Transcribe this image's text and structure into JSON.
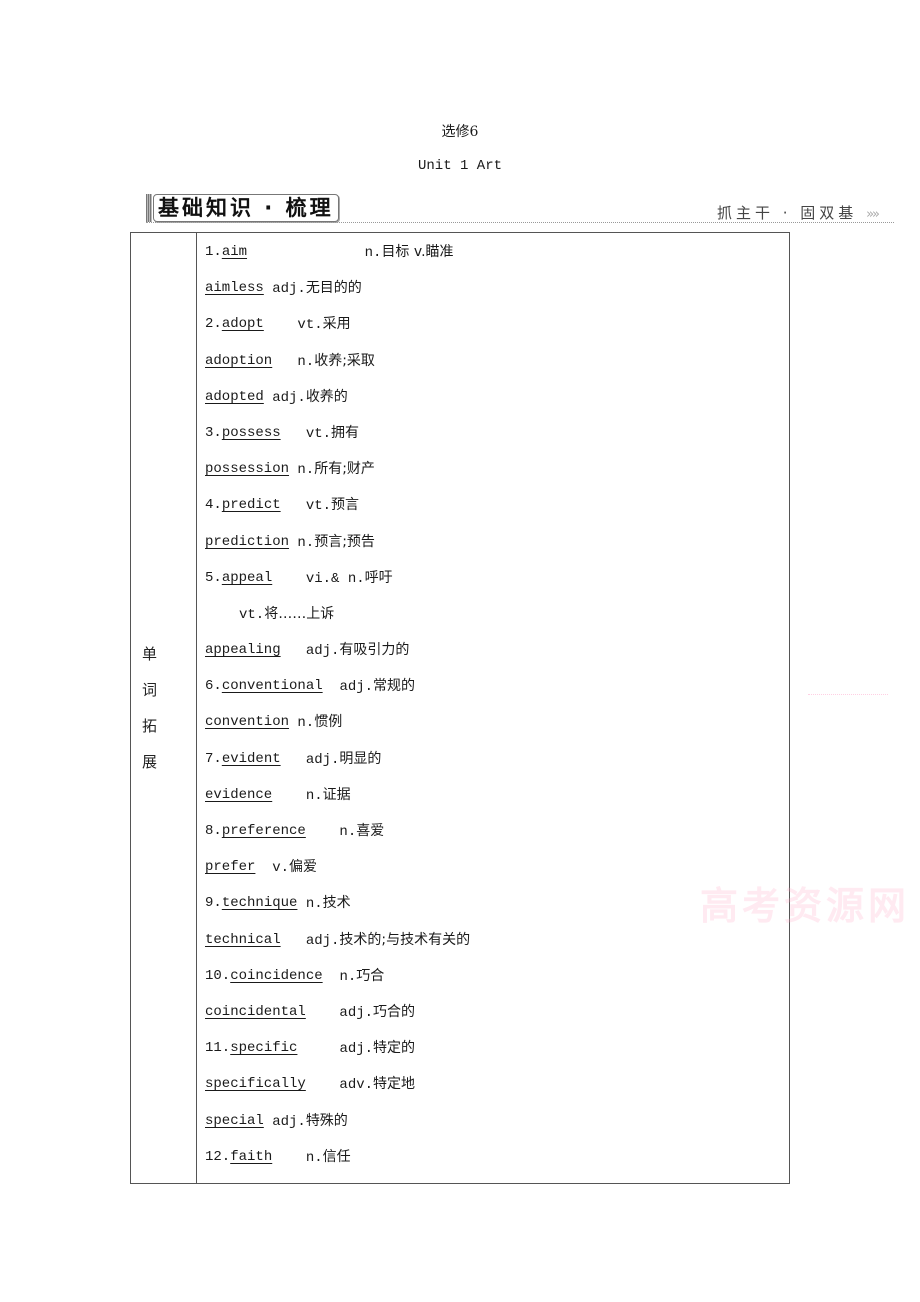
{
  "header": {
    "book": "选修6",
    "unit": "Unit 1  Art",
    "section_banner": "基础知识 · 梳理",
    "slogan": "抓主干 · 固双基",
    "slogan_arrows": "»»"
  },
  "table": {
    "label": [
      "单",
      "词",
      "拓",
      "展"
    ],
    "entries": [
      {
        "num": "1.",
        "word": "aim",
        "gap": 14,
        "pos": "n.",
        "cn": "目标 v.瞄准"
      },
      {
        "num": "",
        "word": "aimless",
        "gap": 1,
        "pos": "adj.",
        "cn": "无目的的"
      },
      {
        "num": "2.",
        "word": "adopt",
        "gap": 4,
        "pos": "vt.",
        "cn": "采用"
      },
      {
        "num": "",
        "word": "adoption",
        "gap": 3,
        "pos": "n.",
        "cn": "收养;采取"
      },
      {
        "num": "",
        "word": "adopted",
        "gap": 1,
        "pos": "adj.",
        "cn": "收养的"
      },
      {
        "num": "3.",
        "word": "possess",
        "gap": 3,
        "pos": "vt.",
        "cn": "拥有"
      },
      {
        "num": "",
        "word": "possession",
        "gap": 1,
        "pos": "n.",
        "cn": "所有;财产"
      },
      {
        "num": "4.",
        "word": "predict",
        "gap": 3,
        "pos": "vt.",
        "cn": "预言"
      },
      {
        "num": "",
        "word": "prediction",
        "gap": 1,
        "pos": "n.",
        "cn": "预言;预告"
      },
      {
        "num": "5.",
        "word": "appeal",
        "gap": 4,
        "pos": "vi.& n.",
        "cn": "呼吁"
      },
      {
        "num": "",
        "word": "",
        "gap": 4,
        "pos": "vt.",
        "cn": "将……上诉"
      },
      {
        "num": "",
        "word": "appealing",
        "gap": 3,
        "pos": "adj.",
        "cn": "有吸引力的"
      },
      {
        "num": "6.",
        "word": "conventional",
        "gap": 2,
        "pos": "adj.",
        "cn": "常规的"
      },
      {
        "num": "",
        "word": "convention",
        "gap": 1,
        "pos": "n.",
        "cn": "惯例"
      },
      {
        "num": "7.",
        "word": "evident",
        "gap": 3,
        "pos": "adj.",
        "cn": "明显的"
      },
      {
        "num": "",
        "word": "evidence",
        "gap": 4,
        "pos": "n.",
        "cn": "证据"
      },
      {
        "num": "8.",
        "word": "preference",
        "gap": 4,
        "pos": "n.",
        "cn": "喜爱"
      },
      {
        "num": "",
        "word": "prefer",
        "gap": 2,
        "pos": "v.",
        "cn": "偏爱"
      },
      {
        "num": "9.",
        "word": "technique",
        "gap": 1,
        "pos": "n.",
        "cn": "技术"
      },
      {
        "num": "",
        "word": "technical",
        "gap": 3,
        "pos": "adj.",
        "cn": "技术的;与技术有关的"
      },
      {
        "num": "10.",
        "word": "coincidence",
        "gap": 2,
        "pos": "n.",
        "cn": "巧合"
      },
      {
        "num": "",
        "word": "coincidental",
        "gap": 4,
        "pos": "adj.",
        "cn": "巧合的"
      },
      {
        "num": "11.",
        "word": "specific",
        "gap": 5,
        "pos": "adj.",
        "cn": "特定的"
      },
      {
        "num": "",
        "word": "specifically",
        "gap": 4,
        "pos": "adv.",
        "cn": "特定地"
      },
      {
        "num": "",
        "word": "special",
        "gap": 1,
        "pos": "adj.",
        "cn": "特殊的"
      },
      {
        "num": "12.",
        "word": "faith",
        "gap": 4,
        "pos": "n.",
        "cn": "信任"
      }
    ]
  },
  "watermark": "高考资源网"
}
